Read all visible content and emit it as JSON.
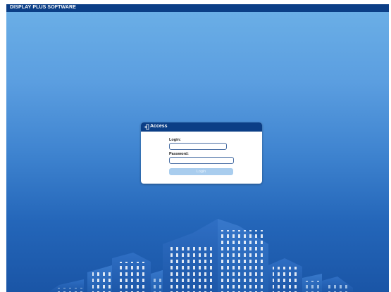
{
  "app": {
    "title": "DISPLAY PLUS SOFTWARE"
  },
  "login_dialog": {
    "title": "Access",
    "icon": "login-door-icon",
    "login_label": "Login:",
    "login_value": "",
    "password_label": "Password:",
    "password_value": "",
    "submit_label": "Login"
  },
  "colors": {
    "header": "#0b3e86",
    "sky_top": "#6aaee6",
    "sky_bottom": "#1a55a6",
    "button_disabled": "#a9cdee"
  }
}
